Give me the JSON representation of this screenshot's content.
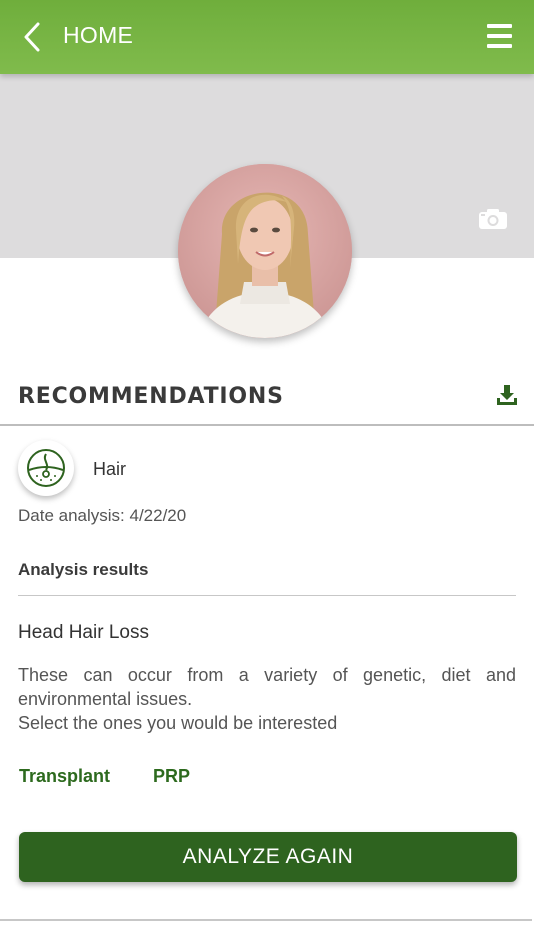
{
  "header": {
    "title": "HOME",
    "back_icon": "chevron-left-icon",
    "menu_icon": "hamburger-menu-icon"
  },
  "profile": {
    "photo_alt": "Profile photo",
    "camera_icon": "camera-icon"
  },
  "recommendations": {
    "title": "RECOMMENDATIONS",
    "download_icon": "download-icon",
    "category": {
      "icon": "hair-follicle-icon",
      "label": "Hair"
    },
    "date_line": "Date analysis: 4/22/20",
    "analysis_title": "Analysis results",
    "condition_title": "Head Hair Loss",
    "description_1": "These can occur from a variety of genetic, diet and environmental issues.",
    "description_2": "Select the ones you would be interested",
    "treatments": [
      "Transplant",
      "PRP"
    ],
    "analyze_button": "ANALYZE AGAIN"
  },
  "colors": {
    "header_green": "#75b342",
    "dark_green": "#2e631f",
    "cover_gray": "#dddcdd"
  }
}
